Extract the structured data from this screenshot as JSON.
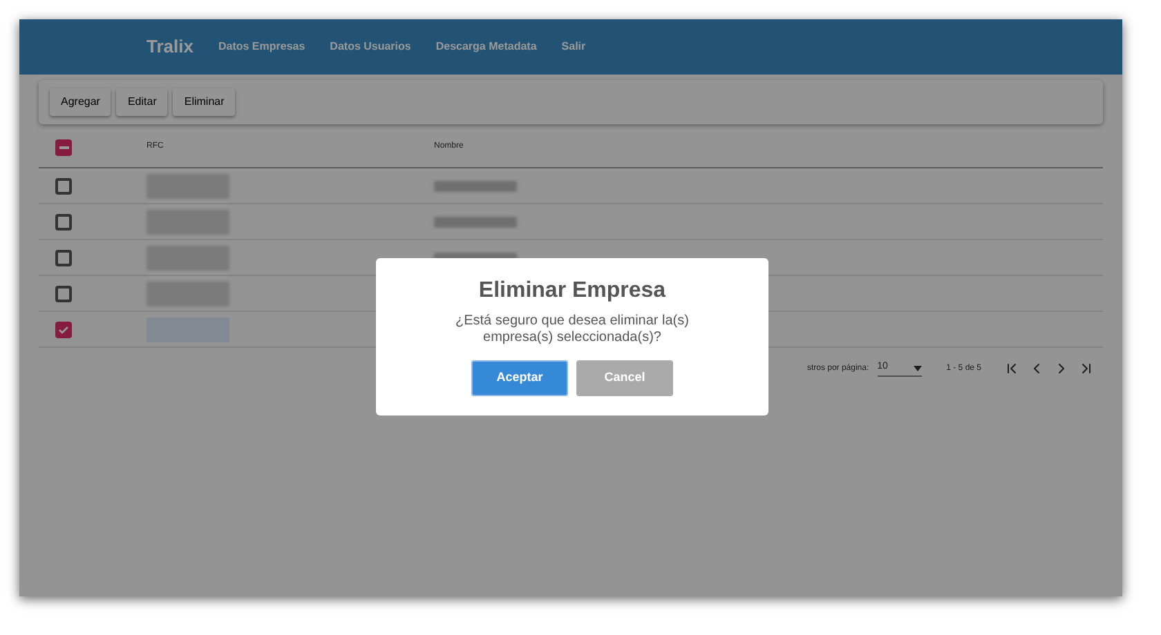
{
  "nav": {
    "brand": "Tralix",
    "links": [
      "Datos Empresas",
      "Datos Usuarios",
      "Descarga Metadata",
      "Salir"
    ]
  },
  "toolbar": [
    "Agregar",
    "Editar",
    "Eliminar"
  ],
  "table": {
    "select_all": {
      "indeterminate": true
    },
    "columns": [
      "RFC",
      "Nombre"
    ],
    "rows": [
      {
        "checked": false
      },
      {
        "checked": false
      },
      {
        "checked": false
      },
      {
        "checked": false
      },
      {
        "checked": true
      }
    ]
  },
  "pagination": {
    "rows_label": "stros por página:",
    "rows_per_page": "10",
    "range": "1 - 5 de 5"
  },
  "dialog": {
    "title": "Eliminar Empresa",
    "message": "¿Está seguro que desea eliminar la(s) empresa(s) seleccionada(s)?",
    "buttons": [
      {
        "label": "Aceptar",
        "kind": "primary"
      },
      {
        "label": "Cancel",
        "kind": "secondary"
      }
    ]
  }
}
